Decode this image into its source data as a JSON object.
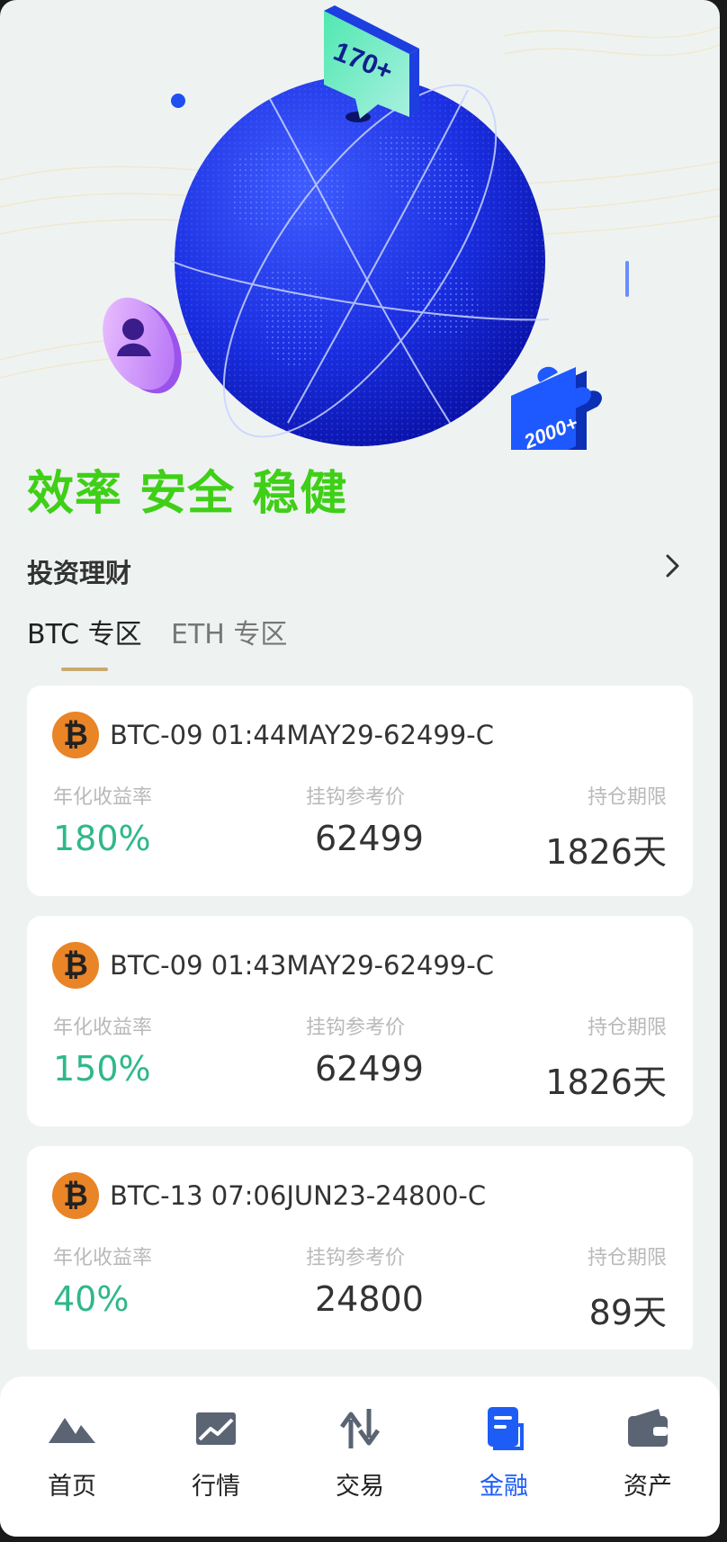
{
  "hero": {
    "badge_top": "170+",
    "badge_bottom": "2000+",
    "slogan": "效率 安全 稳健"
  },
  "section": {
    "title": "投资理财"
  },
  "tabs": [
    {
      "label": "BTC 专区",
      "active": true
    },
    {
      "label": "ETH 专区",
      "active": false
    }
  ],
  "cards": [
    {
      "coin": "BTC",
      "name": "BTC-09 01:44MAY29-62499-C",
      "rate_label": "年化收益率",
      "rate": "180%",
      "price_label": "挂钩参考价",
      "price": "62499",
      "term_label": "持仓期限",
      "term": "1826天"
    },
    {
      "coin": "BTC",
      "name": "BTC-09 01:43MAY29-62499-C",
      "rate_label": "年化收益率",
      "rate": "150%",
      "price_label": "挂钩参考价",
      "price": "62499",
      "term_label": "持仓期限",
      "term": "1826天"
    },
    {
      "coin": "BTC",
      "name": "BTC-13 07:06JUN23-24800-C",
      "rate_label": "年化收益率",
      "rate": "40%",
      "price_label": "挂钩参考价",
      "price": "24800",
      "term_label": "持仓期限",
      "term": "89天"
    }
  ],
  "nav": [
    {
      "label": "首页",
      "icon": "mountain-icon",
      "active": false
    },
    {
      "label": "行情",
      "icon": "chart-icon",
      "active": false
    },
    {
      "label": "交易",
      "icon": "swap-arrows-icon",
      "active": false
    },
    {
      "label": "金融",
      "icon": "document-icon",
      "active": true
    },
    {
      "label": "资产",
      "icon": "wallet-icon",
      "active": false
    }
  ],
  "colors": {
    "background": "#eef3f2",
    "slogan": "#3fcf17",
    "rate": "#2fb88a",
    "tab_underline": "#c9a96e",
    "nav_active": "#1d5df5",
    "coin": "#e98427"
  }
}
